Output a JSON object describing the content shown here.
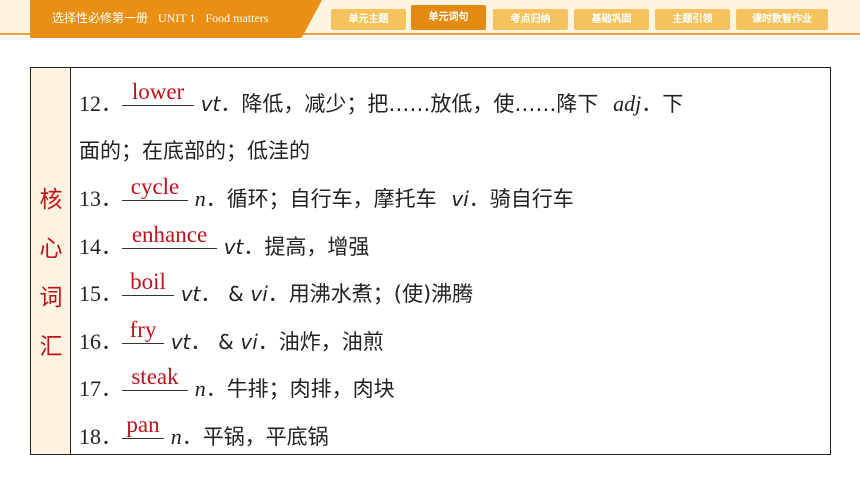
{
  "header": {
    "book": "选择性必修第一册",
    "unit": "UNIT 1",
    "topic": "Food matters",
    "tabs": [
      {
        "label": "单元主题",
        "active": false
      },
      {
        "label": "单元词句",
        "active": true
      },
      {
        "label": "考点归纳",
        "active": false
      },
      {
        "label": "基础巩固",
        "active": false
      },
      {
        "label": "主题引领",
        "active": false
      },
      {
        "label": "课时数智作业",
        "active": false
      }
    ]
  },
  "side_label": [
    "核",
    "心",
    "词",
    "汇"
  ],
  "entries": [
    {
      "num": "12",
      "answer": "lower",
      "pos1": "vt",
      "def1": "降低，减少；把……放低，使……降下",
      "pos2": "adj",
      "def2": "下",
      "cont": "面的；在底部的；低洼的"
    },
    {
      "num": "13",
      "answer": "cycle",
      "pos1": "n",
      "def1": "循环；自行车，摩托车",
      "pos2": "vi",
      "def2": "骑自行车"
    },
    {
      "num": "14",
      "answer": "enhance",
      "pos1": "vt",
      "def1": "提高，增强"
    },
    {
      "num": "15",
      "answer": "boil",
      "pos1": "vt",
      "conj": "&",
      "pos2": "vi",
      "def2": "用沸水煮；(使)沸腾"
    },
    {
      "num": "16",
      "answer": "fry",
      "pos1": "vt",
      "conj": "&",
      "pos2": "vi",
      "def2": "油炸，油煎"
    },
    {
      "num": "17",
      "answer": "steak",
      "pos1": "n",
      "def1": "牛排；肉排，肉块"
    },
    {
      "num": "18",
      "answer": "pan",
      "pos1": "n",
      "def1": "平锅，平底锅"
    }
  ],
  "colors": {
    "accent": "#e88f14",
    "answer_red": "#c0121b",
    "side_bg": "#fdf3e0"
  }
}
